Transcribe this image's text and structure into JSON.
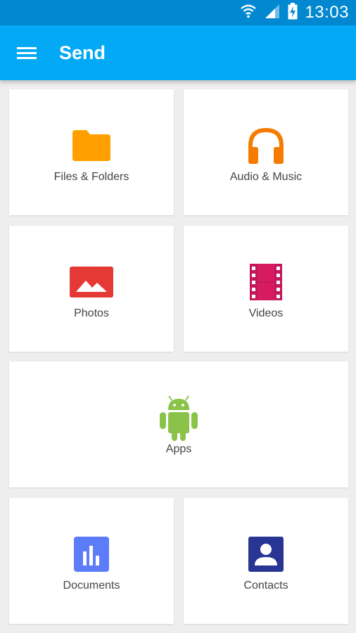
{
  "status_bar": {
    "time": "13:03",
    "icons": [
      "wifi-icon",
      "signal-icon",
      "battery-charging-icon"
    ]
  },
  "app_bar": {
    "title": "Send",
    "menu_icon": "hamburger-menu-icon"
  },
  "categories": [
    {
      "label": "Files & Folders",
      "icon": "folder-icon",
      "color": "#ffa000"
    },
    {
      "label": "Audio & Music",
      "icon": "headphones-icon",
      "color": "#f57c00"
    },
    {
      "label": "Photos",
      "icon": "image-icon",
      "color": "#e53935"
    },
    {
      "label": "Videos",
      "icon": "film-icon",
      "color": "#c2185b"
    },
    {
      "label": "Apps",
      "icon": "android-icon",
      "color": "#8bc34a"
    },
    {
      "label": "Documents",
      "icon": "document-chart-icon",
      "color": "#5c7cfa"
    },
    {
      "label": "Contacts",
      "icon": "contact-icon",
      "color": "#283593"
    }
  ],
  "colors": {
    "status_bar": "#0288d1",
    "app_bar": "#03a9f4",
    "background": "#eeeeee"
  }
}
